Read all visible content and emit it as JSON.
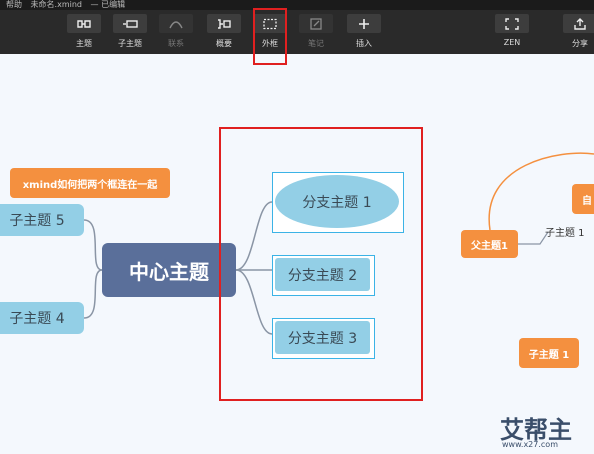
{
  "menu": {
    "help": "帮助",
    "file_title": "未命名.xmind",
    "status": "— 已编辑"
  },
  "toolbar": {
    "topic": "主题",
    "subtopic": "子主题",
    "relation": "联系",
    "summary": "概要",
    "boundary": "外框",
    "note": "笔记",
    "insert": "插入",
    "zen": "ZEN",
    "share": "分享"
  },
  "map": {
    "center": "中心主题",
    "branch1": "分支主题 1",
    "branch2": "分支主题 2",
    "branch3": "分支主题 3",
    "sub5": "子主题 5",
    "sub4": "子主题 4",
    "callout": "xmind如何把两个框连在一起",
    "parent": "父主题1",
    "child_plain": "子主题 1",
    "child_box": "子主题 1",
    "custom": "自"
  },
  "watermark": {
    "text": "艾帮主",
    "url": "www.x27.com"
  },
  "colors": {
    "highlight": "#e02020",
    "accent": "#f4903f",
    "center": "#5a6f9a",
    "subtopic": "#93cfe6"
  },
  "icons": [
    "topic-icon",
    "subtopic-icon",
    "relation-icon",
    "summary-icon",
    "boundary-icon",
    "note-icon",
    "insert-icon",
    "zen-icon",
    "share-icon"
  ]
}
